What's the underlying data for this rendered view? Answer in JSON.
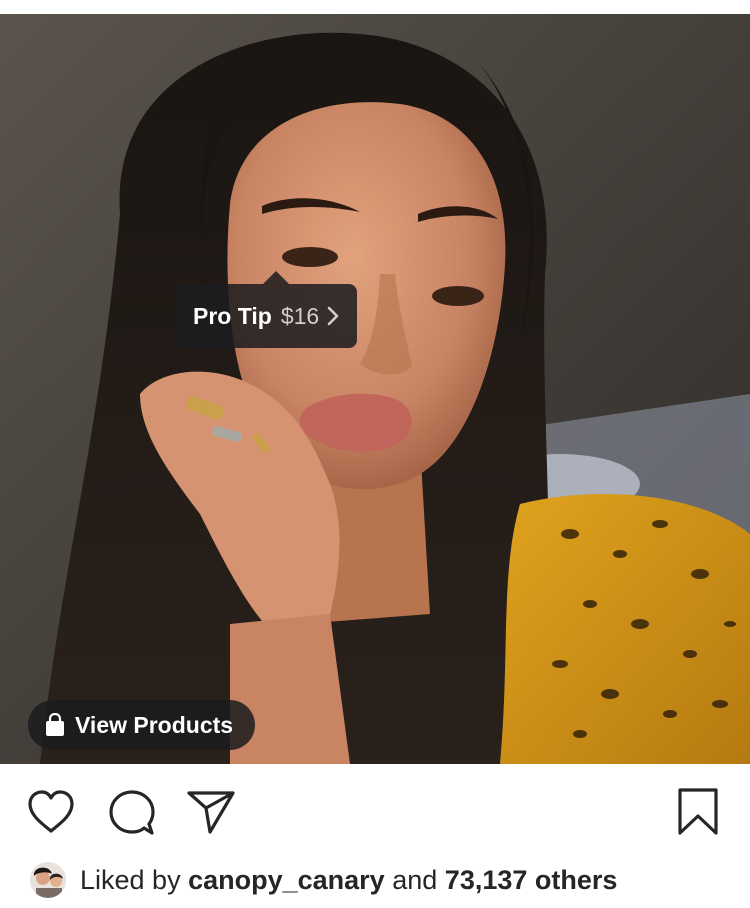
{
  "post": {
    "product_tag": {
      "name": "Pro Tip",
      "price": "$16"
    },
    "view_products_label": "View Products"
  },
  "actions": {
    "like_icon": "heart-icon",
    "comment_icon": "comment-icon",
    "share_icon": "send-icon",
    "save_icon": "bookmark-icon"
  },
  "likes": {
    "prefix": "Liked by",
    "username": "canopy_canary",
    "connector": "and",
    "others": "73,137 others"
  },
  "colors": {
    "text": "#262626",
    "overlay": "#1c1c1e"
  }
}
